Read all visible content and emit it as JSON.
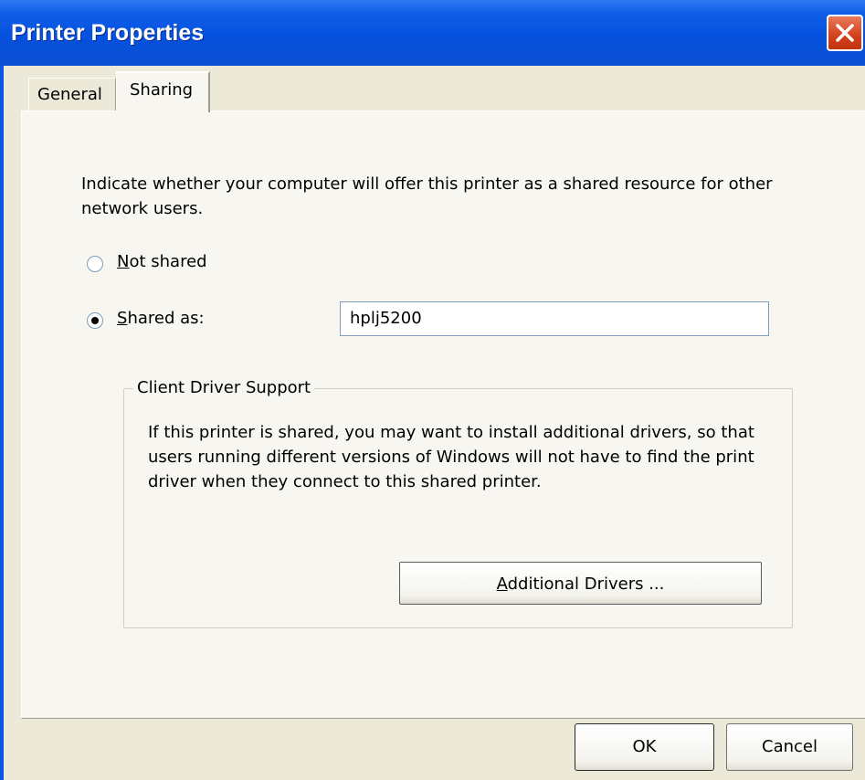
{
  "window": {
    "title": "Printer Properties"
  },
  "tabs": [
    {
      "label": "General",
      "active": false
    },
    {
      "label": "Sharing",
      "active": true
    }
  ],
  "sharing": {
    "intro": "Indicate whether your computer will offer this printer as a shared resource for other network users.",
    "not_shared": {
      "label_accel": "N",
      "label_rest": "ot shared",
      "checked": false
    },
    "shared_as": {
      "label_accel": "S",
      "label_rest": "hared as:",
      "checked": true,
      "value": "hplj5200"
    },
    "client_driver": {
      "title": "Client Driver Support",
      "text": "If this printer is shared, you may want to install additional drivers, so that users running different versions of Windows will not have to find the print driver when they connect to this shared printer.",
      "button_accel": "A",
      "button_rest": "dditional Drivers ..."
    }
  },
  "footer": {
    "ok": "OK",
    "cancel": "Cancel"
  },
  "colors": {
    "titlebar": "#0550dd",
    "dialog_bg": "#ece9d8",
    "panel_bg": "#f7f6f0",
    "close": "#d3411b"
  },
  "icons": {
    "close": "close-icon"
  }
}
